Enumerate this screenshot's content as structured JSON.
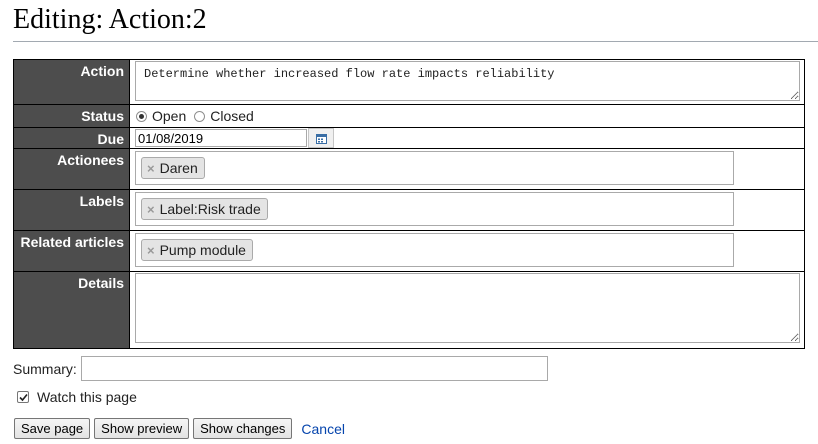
{
  "page": {
    "title": "Editing: Action:2"
  },
  "form": {
    "action": {
      "label": "Action",
      "value": "Determine whether increased flow rate impacts reliability"
    },
    "status": {
      "label": "Status",
      "options": [
        "Open",
        "Closed"
      ],
      "selected": "Open"
    },
    "due": {
      "label": "Due",
      "value": "01/08/2019",
      "calendar_icon": "calendar-icon"
    },
    "actionees": {
      "label": "Actionees",
      "tags": [
        "Daren"
      ]
    },
    "labels": {
      "label": "Labels",
      "tags": [
        "Label:Risk trade"
      ]
    },
    "related": {
      "label": "Related articles",
      "tags": [
        "Pump module"
      ]
    },
    "details": {
      "label": "Details",
      "value": ""
    }
  },
  "summary": {
    "label": "Summary:",
    "value": ""
  },
  "watch": {
    "label": "Watch this page",
    "checked": true
  },
  "buttons": {
    "save": "Save page",
    "preview": "Show preview",
    "changes": "Show changes",
    "cancel": "Cancel"
  },
  "colors": {
    "label_bg": "#4d4d4d",
    "link": "#0645ad"
  }
}
